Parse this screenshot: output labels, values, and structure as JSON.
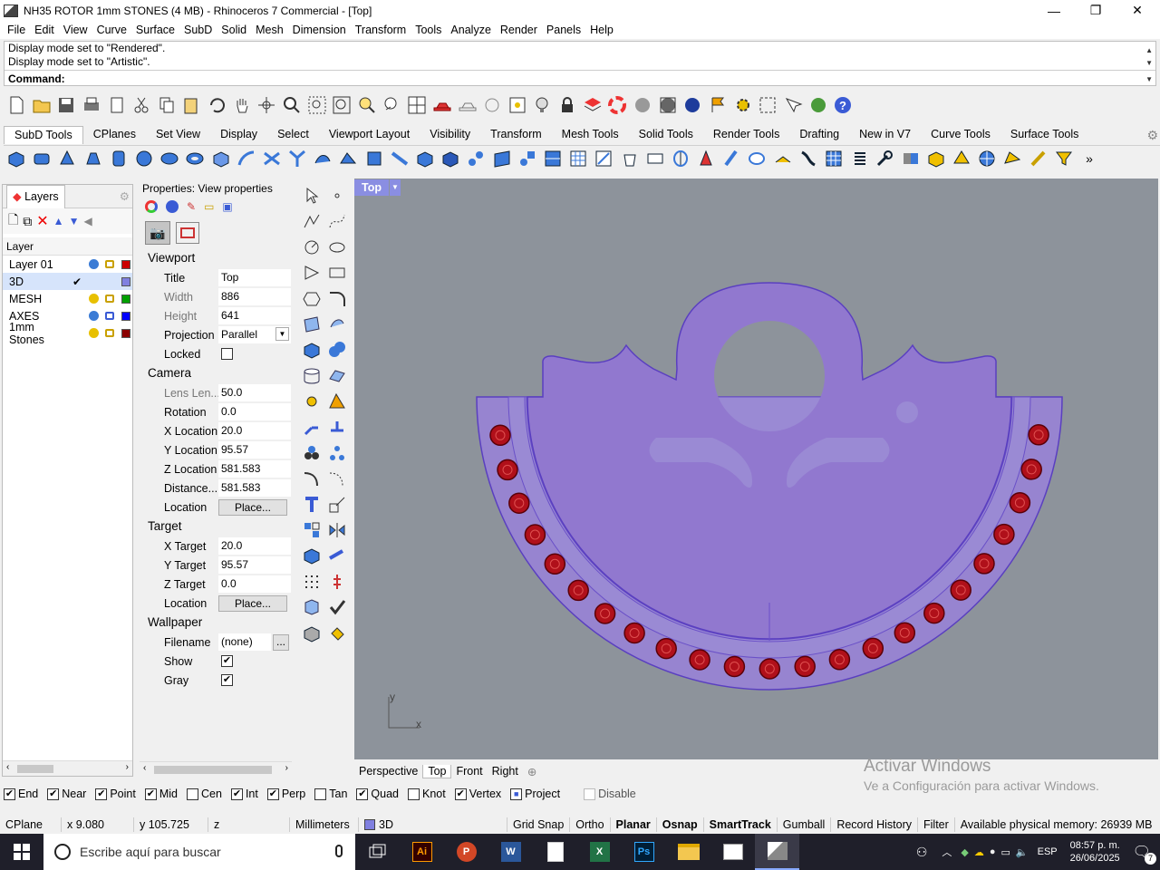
{
  "window": {
    "title": "NH35 ROTOR 1mm STONES (4 MB) - Rhinoceros 7 Commercial - [Top]",
    "minimize": "—",
    "restore": "❐",
    "close": "✕"
  },
  "menu": [
    "File",
    "Edit",
    "View",
    "Curve",
    "Surface",
    "SubD",
    "Solid",
    "Mesh",
    "Dimension",
    "Transform",
    "Tools",
    "Analyze",
    "Render",
    "Panels",
    "Help"
  ],
  "command_history": [
    "Display mode set to \"Rendered\".",
    "Display mode set to \"Artistic\"."
  ],
  "command_prompt": "Command:",
  "toolbar_tabs": [
    "SubD Tools",
    "CPlanes",
    "Set View",
    "Display",
    "Select",
    "Viewport Layout",
    "Visibility",
    "Transform",
    "Mesh Tools",
    "Solid Tools",
    "Render Tools",
    "Drafting",
    "New in V7",
    "Curve Tools",
    "Surface Tools"
  ],
  "layers": {
    "tab_label": "Layers",
    "column_header": "Layer",
    "rows": [
      {
        "name": "Layer 01",
        "current": "",
        "bulb": "#3a7bd5",
        "color": "#cc0000"
      },
      {
        "name": "3D",
        "current": "✔",
        "bulb": "#3a7bd5",
        "color": "#8080e0"
      },
      {
        "name": "MESH",
        "current": "",
        "bulb": "#e8c000",
        "color": "#00a000"
      },
      {
        "name": "AXES",
        "current": "",
        "bulb": "#3a7bd5",
        "color": "#0000ff"
      },
      {
        "name": "1mm Stones",
        "current": "",
        "bulb": "#e8c000",
        "color": "#8b0000"
      }
    ]
  },
  "properties": {
    "header": "Properties: View properties",
    "viewport_section": "Viewport",
    "title_label": "Title",
    "title_value": "Top",
    "width_label": "Width",
    "width_value": "886",
    "height_label": "Height",
    "height_value": "641",
    "projection_label": "Projection",
    "projection_value": "Parallel",
    "locked_label": "Locked",
    "camera_section": "Camera",
    "lens_label": "Lens Len...",
    "lens_value": "50.0",
    "rotation_label": "Rotation",
    "rotation_value": "0.0",
    "xloc_label": "X Location",
    "xloc_value": "20.0",
    "yloc_label": "Y Location",
    "yloc_value": "95.57",
    "zloc_label": "Z Location",
    "zloc_value": "581.583",
    "dist_label": "Distance...",
    "dist_value": "581.583",
    "location_label": "Location",
    "place_button": "Place...",
    "target_section": "Target",
    "xtarget_label": "X Target",
    "xtarget_value": "20.0",
    "ytarget_label": "Y Target",
    "ytarget_value": "95.57",
    "ztarget_label": "Z Target",
    "ztarget_value": "0.0",
    "tlocation_label": "Location",
    "tplace_button": "Place...",
    "wallpaper_section": "Wallpaper",
    "filename_label": "Filename",
    "filename_value": "(none)",
    "browse_button": "...",
    "show_label": "Show",
    "show_checked": "✔",
    "gray_label": "Gray",
    "gray_checked": "✔"
  },
  "viewport": {
    "name": "Top",
    "axis_x": "x",
    "axis_y": "y",
    "tabs": [
      "Perspective",
      "Top",
      "Front",
      "Right"
    ],
    "add_tab": "⊕"
  },
  "watermark": {
    "line1": "Activar Windows",
    "line2": "Ve a Configuración para activar Windows."
  },
  "osnaps": [
    {
      "label": "End",
      "checked": "✔"
    },
    {
      "label": "Near",
      "checked": "✔"
    },
    {
      "label": "Point",
      "checked": "✔"
    },
    {
      "label": "Mid",
      "checked": "✔"
    },
    {
      "label": "Cen",
      "checked": ""
    },
    {
      "label": "Int",
      "checked": "✔"
    },
    {
      "label": "Perp",
      "checked": "✔"
    },
    {
      "label": "Tan",
      "checked": ""
    },
    {
      "label": "Quad",
      "checked": "✔"
    },
    {
      "label": "Knot",
      "checked": ""
    },
    {
      "label": "Vertex",
      "checked": "✔"
    },
    {
      "label": "Project",
      "checked": "■"
    },
    {
      "label": "Disable",
      "checked": ""
    }
  ],
  "status": {
    "cplane": "CPlane",
    "x": "x 9.080",
    "y": "y 105.725",
    "z": "z",
    "units": "Millimeters",
    "layer": "3D",
    "grid_snap": "Grid Snap",
    "ortho": "Ortho",
    "planar": "Planar",
    "osnap": "Osnap",
    "smarttrack": "SmartTrack",
    "gumball": "Gumball",
    "record_history": "Record History",
    "filter": "Filter",
    "memory": "Available physical memory: 26939 MB"
  },
  "taskbar": {
    "search_placeholder": "Escribe aquí para buscar",
    "lang": "ESP",
    "time": "08:57 p. m.",
    "date": "26/06/2025",
    "notifications": "7"
  },
  "colors": {
    "viewport_bg": "#8d939b",
    "part_fill": "#9784d0",
    "part_edge": "#5a3fc0",
    "stone": "#b0101a"
  }
}
